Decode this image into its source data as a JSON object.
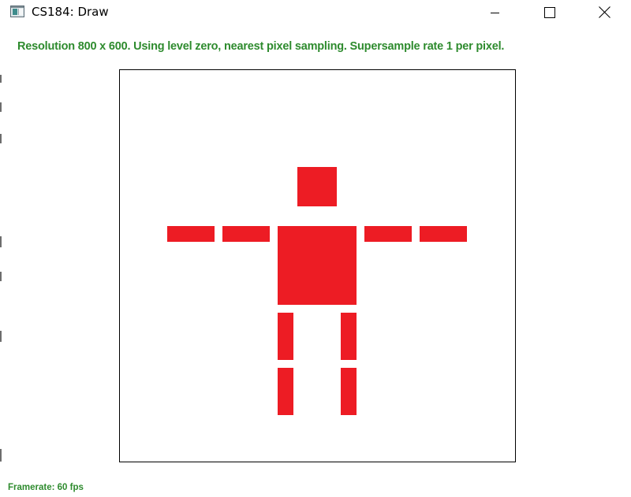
{
  "window": {
    "title": "CS184: Draw",
    "icon": "app-window-icon",
    "controls": {
      "minimize": "minimize-icon",
      "maximize": "maximize-icon",
      "close": "close-icon"
    }
  },
  "status": {
    "text": "Resolution 800 x 600. Using level zero, nearest pixel sampling. Supersample rate 1 per pixel.",
    "color": "#2e8b2e"
  },
  "footer": {
    "framerate": "Framerate: 60 fps"
  },
  "figure": {
    "fill": "#ed1c24",
    "background": "#ffffff",
    "border": "#000000"
  }
}
